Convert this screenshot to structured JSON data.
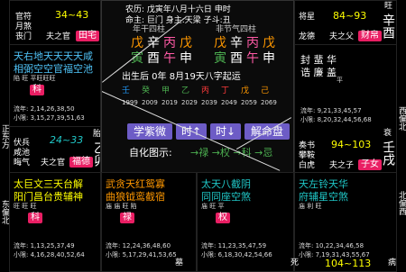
{
  "app": {
    "title": "紫微斗数命盘"
  },
  "side_labels": {
    "left_top": "正东方",
    "left_bottom": "东偏北",
    "right_top": "西偏北",
    "right_bottom": "北偏西"
  },
  "top_left_box": {
    "ages": "34~43",
    "small_labels": [
      "官符",
      "月煞",
      "丧门"
    ],
    "tag": "夫之官",
    "palace": "田宅",
    "stem_branch": "丙辰",
    "right_mark": "养"
  },
  "top_right_box": {
    "ages": "84~93",
    "small_labels": [
      "将星",
      "龙德"
    ],
    "tag": "夫之父",
    "palace": "财帛",
    "stem_branch": "辛酉",
    "right_mark": "旺"
  },
  "mid_left_box": {
    "stars": "天右地天天天天咸",
    "stars2": "相弼空空官福空池",
    "states": "陷 旺 平旺旺旺",
    "ke": "科",
    "years1": "流年: 2,14,26,38,50",
    "years2": "小限: 3,15,27,39,51,63"
  },
  "left_middle": {
    "ages": "24~33",
    "small_labels": [
      "伏兵",
      "咸池",
      "晦气"
    ],
    "tag": "夫之官",
    "palace": "福德",
    "stem_branch": "乙卯",
    "right_mark": "胎"
  },
  "right_middle": {
    "stars": "封 蜚 华",
    "stars2": "诰 廉 盖",
    "state": "平",
    "years1": "流年: 9,21,33,45,57",
    "years2": "小限: 8,20,32,44,56,68",
    "ages": "94~103",
    "small_labels": [
      "奏书",
      "攀鞍",
      "白虎"
    ],
    "tag": "夫之子",
    "palace": "子女",
    "stem_branch": "壬戌",
    "right_mark": "衰"
  },
  "center": {
    "line1": "农历: 戊寅年八月十六日 申时",
    "line2": "命主: 巨门 身主:天梁 子斗:丑",
    "col1_label": "年干四柱",
    "col2_label": "非节气四柱",
    "pillars_left": [
      "戊",
      "辛",
      "丙",
      "戊"
    ],
    "pillars_left2": [
      "寅",
      "酉",
      "午",
      "申"
    ],
    "pillars_right": [
      "戊",
      "辛",
      "丙",
      "戊"
    ],
    "pillars_right2": [
      "寅",
      "酉",
      "午",
      "申"
    ],
    "birth": "出生后 0年 8月19天八字起运",
    "dayun_years": [
      "1999",
      "2009",
      "2019",
      "2029",
      "2039",
      "2049",
      "2059",
      "2069"
    ],
    "btn_ziwei": "学紫微",
    "btn_time_plus": "时↑",
    "btn_time_minus": "时↓",
    "btn_explain": "解命盘",
    "self_hua": "自化图示:",
    "hua_legend": "→禄 →权 →科 →忌"
  },
  "bottom_cells": [
    {
      "stars": "太巨文三天台解",
      "stars2": "阳门昌台贵辅神",
      "states": "旺 旺 旺",
      "badge": "科",
      "years1": "流年: 1,13,25,37,49",
      "years2": "小限: 4,16,28,40,52,64"
    },
    {
      "stars": "武贪天红鸳寡",
      "stars2": "曲狼钺鸾截宿",
      "states": "庙 庙 旺 陷",
      "badge": "禄",
      "years1": "流年: 12,24,36,48,60",
      "years2": "小限: 5,17,29,41,53,65"
    },
    {
      "stars": "太天八截阴",
      "stars2": "同同座空煞",
      "states": "庙 旺 平",
      "badge": "权",
      "years1": "流年: 11,23,35,47,59",
      "years2": "小限: 6,18,30,42,54,66"
    },
    {
      "stars": "天左铃天华",
      "stars2": "府辅星空煞",
      "states": "庙 利 旺",
      "badge": "",
      "years1": "流年: 10,22,34,46,58",
      "years2": "小限: 7,19,31,43,55,67"
    }
  ],
  "bottom_strip": {
    "left_mark": "墓",
    "right_ages": "104~113",
    "right_mark": "死",
    "right_corner": "病"
  }
}
